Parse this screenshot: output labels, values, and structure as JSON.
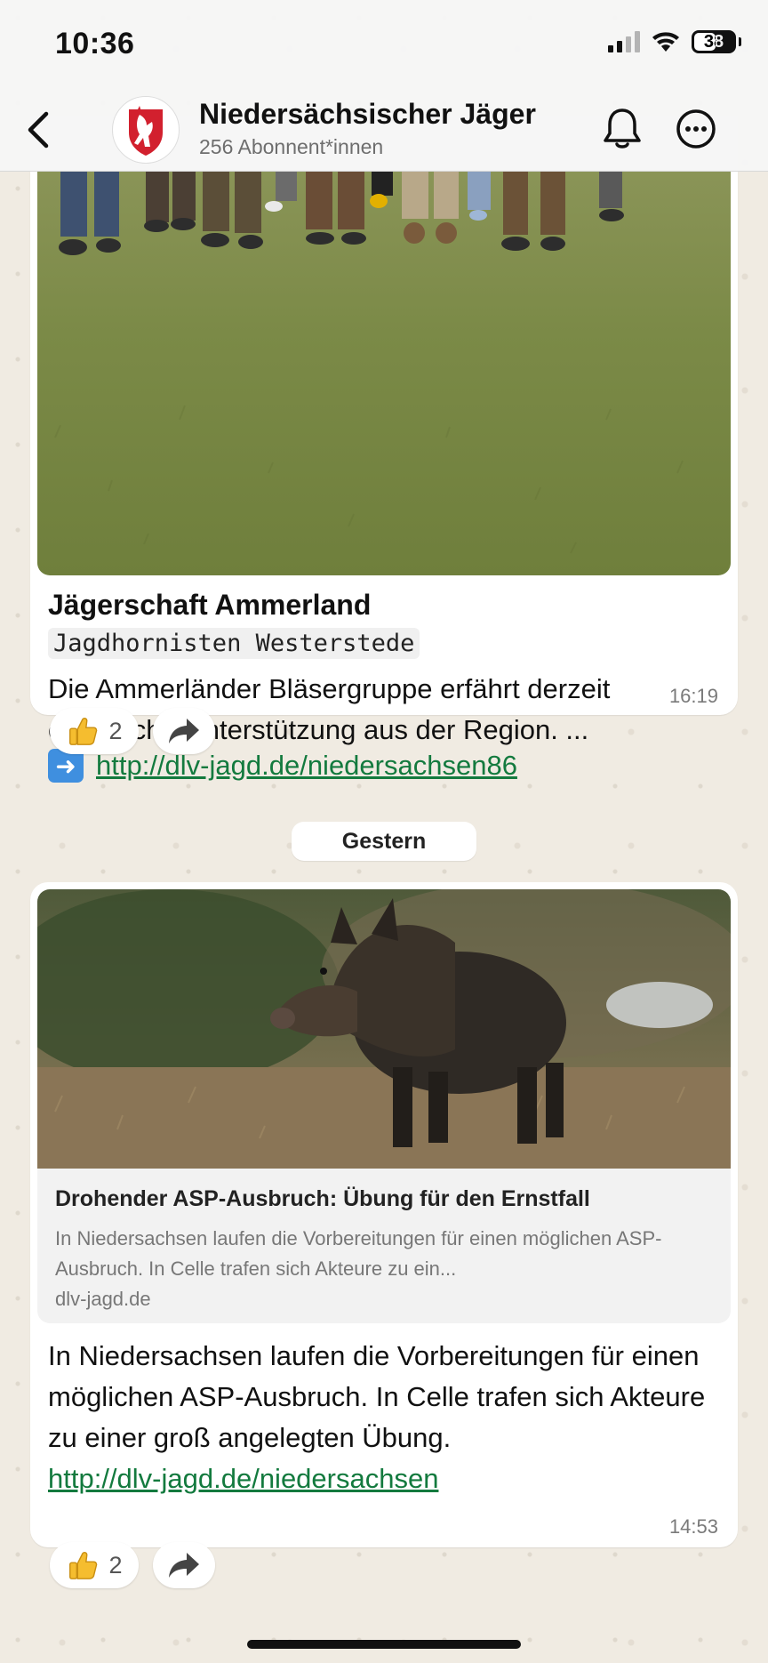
{
  "status_bar": {
    "time": "10:36",
    "battery": "38"
  },
  "header": {
    "channel_name": "Niedersächsischer Jäger",
    "subscribers": "256 Abonnent*innen"
  },
  "messages": [
    {
      "title": "Jägerschaft Ammerland",
      "subtitle_mono": "Jagdhornisten Westerstede",
      "text": "Die Ammerländer Bläsergruppe erfährt derzeit erfreuliche Unterstützung aus der Region. ...",
      "link": "http://dlv-jagd.de/niedersachsen86",
      "time": "16:19",
      "reaction": {
        "emoji": "thumbs-up",
        "count": "2"
      }
    },
    {
      "preview": {
        "title": "Drohender ASP-Ausbruch: Übung für den Ernstfall",
        "description": "In Niedersachsen laufen die Vorbereitungen für einen möglichen ASP-Ausbruch. In Celle trafen sich Akteure zu ein...",
        "domain": "dlv-jagd.de"
      },
      "text": "In Niedersachsen laufen die Vorbereitungen für einen möglichen ASP-Ausbruch. In Celle trafen sich Akteure zu einer groß angelegten Übung.",
      "link": "http://dlv-jagd.de/niedersachsen",
      "time": "14:53",
      "reaction": {
        "emoji": "thumbs-up",
        "count": "2"
      }
    }
  ],
  "day_separator": "Gestern",
  "colors": {
    "link": "#137a3e",
    "accent_red": "#d2202e",
    "wallpaper": "#f0ebe2"
  },
  "icons": [
    "back-chevron-icon",
    "bell-icon",
    "more-icon",
    "share-forward-icon",
    "thumbs-up-icon",
    "arrow-right-emoji-icon"
  ]
}
